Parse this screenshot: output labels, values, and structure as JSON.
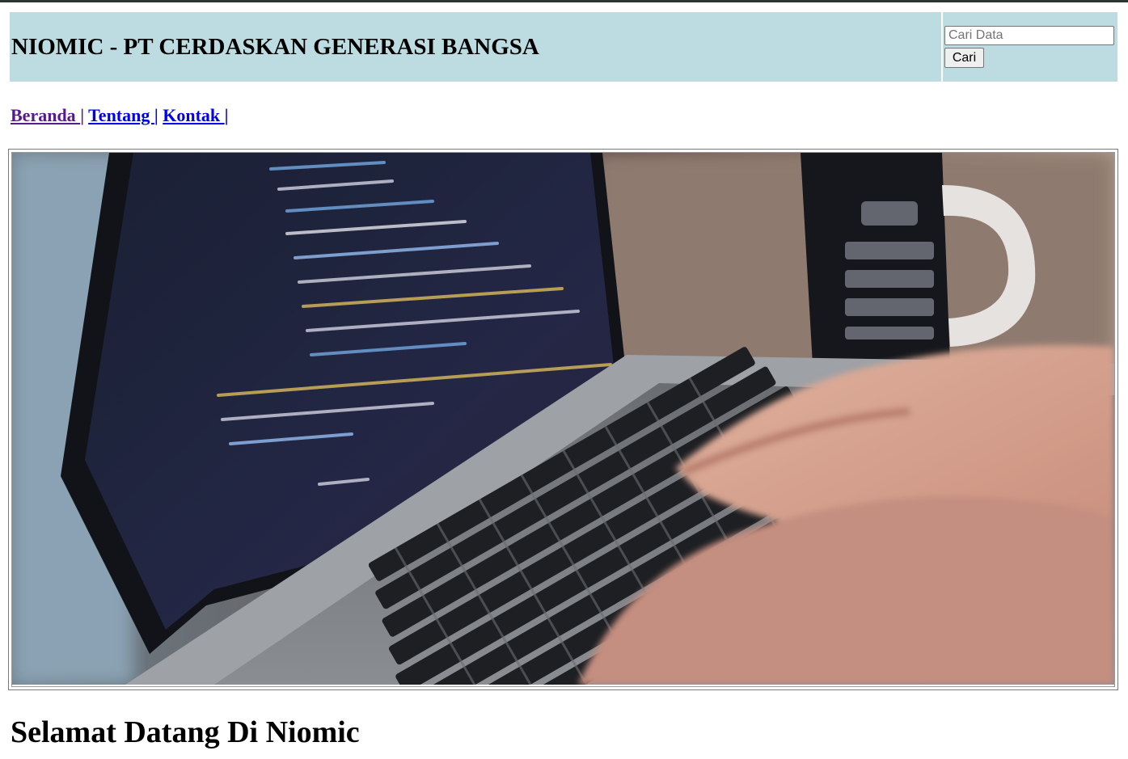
{
  "header": {
    "title": "NIOMIC - PT CERDASKAN GENERASI BANGSA",
    "search": {
      "placeholder": "Cari Data",
      "value": "",
      "button_label": "Cari"
    }
  },
  "nav": {
    "items": [
      {
        "label": "Beranda ",
        "separator": "|"
      },
      {
        "label": "Tentang ",
        "separator": "|"
      },
      {
        "label": "Kontak ",
        "separator": "|"
      }
    ]
  },
  "banner": {
    "image_semantic": "laptop-coding-photo"
  },
  "main": {
    "heading": "Selamat Datang Di Niomic"
  },
  "colors": {
    "header_bg": "#bcdce1",
    "link": "#0000ee",
    "link_visited": "#551a8b"
  }
}
